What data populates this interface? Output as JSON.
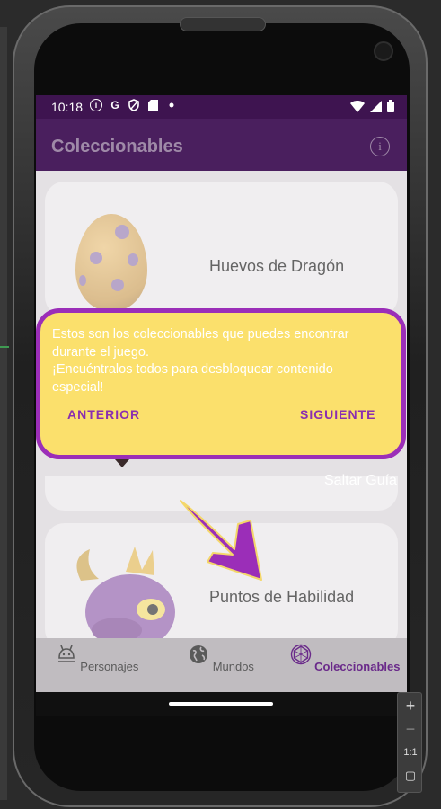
{
  "status_bar": {
    "time": "10:18",
    "icons": [
      "info-icon",
      "google-icon",
      "vpn-shield-icon",
      "sd-card-icon",
      "dot-icon"
    ],
    "right_icons": [
      "wifi-icon",
      "signal-icon",
      "battery-icon"
    ]
  },
  "app_bar": {
    "title": "Coleccionables",
    "info_icon": "info-icon"
  },
  "cards": [
    {
      "label": "Huevos de Dragón",
      "image": "dragon-egg-image"
    },
    {
      "label": "Puntos de Habilidad",
      "image": "spyro-image"
    }
  ],
  "tooltip": {
    "text": "Estos son los coleccionables que puedes encontrar\ndurante el juego.\n¡Encuéntralos todos para desbloquear contenido\nespecial!",
    "prev_label": "ANTERIOR",
    "next_label": "SIGUIENTE"
  },
  "skip_label": "Saltar Guía",
  "bottom_nav": [
    {
      "label": "Personajes",
      "icon": "dragon-head-icon",
      "active": false
    },
    {
      "label": "Mundos",
      "icon": "globe-icon",
      "active": false
    },
    {
      "label": "Coleccionables",
      "icon": "gem-icon",
      "active": true
    }
  ],
  "zoom_panel": {
    "zoom_in": "+",
    "zoom_out": "−",
    "ratio": "1:1"
  },
  "colors": {
    "app_bar": "#4a1f5e",
    "tooltip_bg": "#fbe06c",
    "tooltip_border": "#9b2eb8",
    "accent": "#8a2eb0",
    "arrow": "#9b2eb8"
  }
}
